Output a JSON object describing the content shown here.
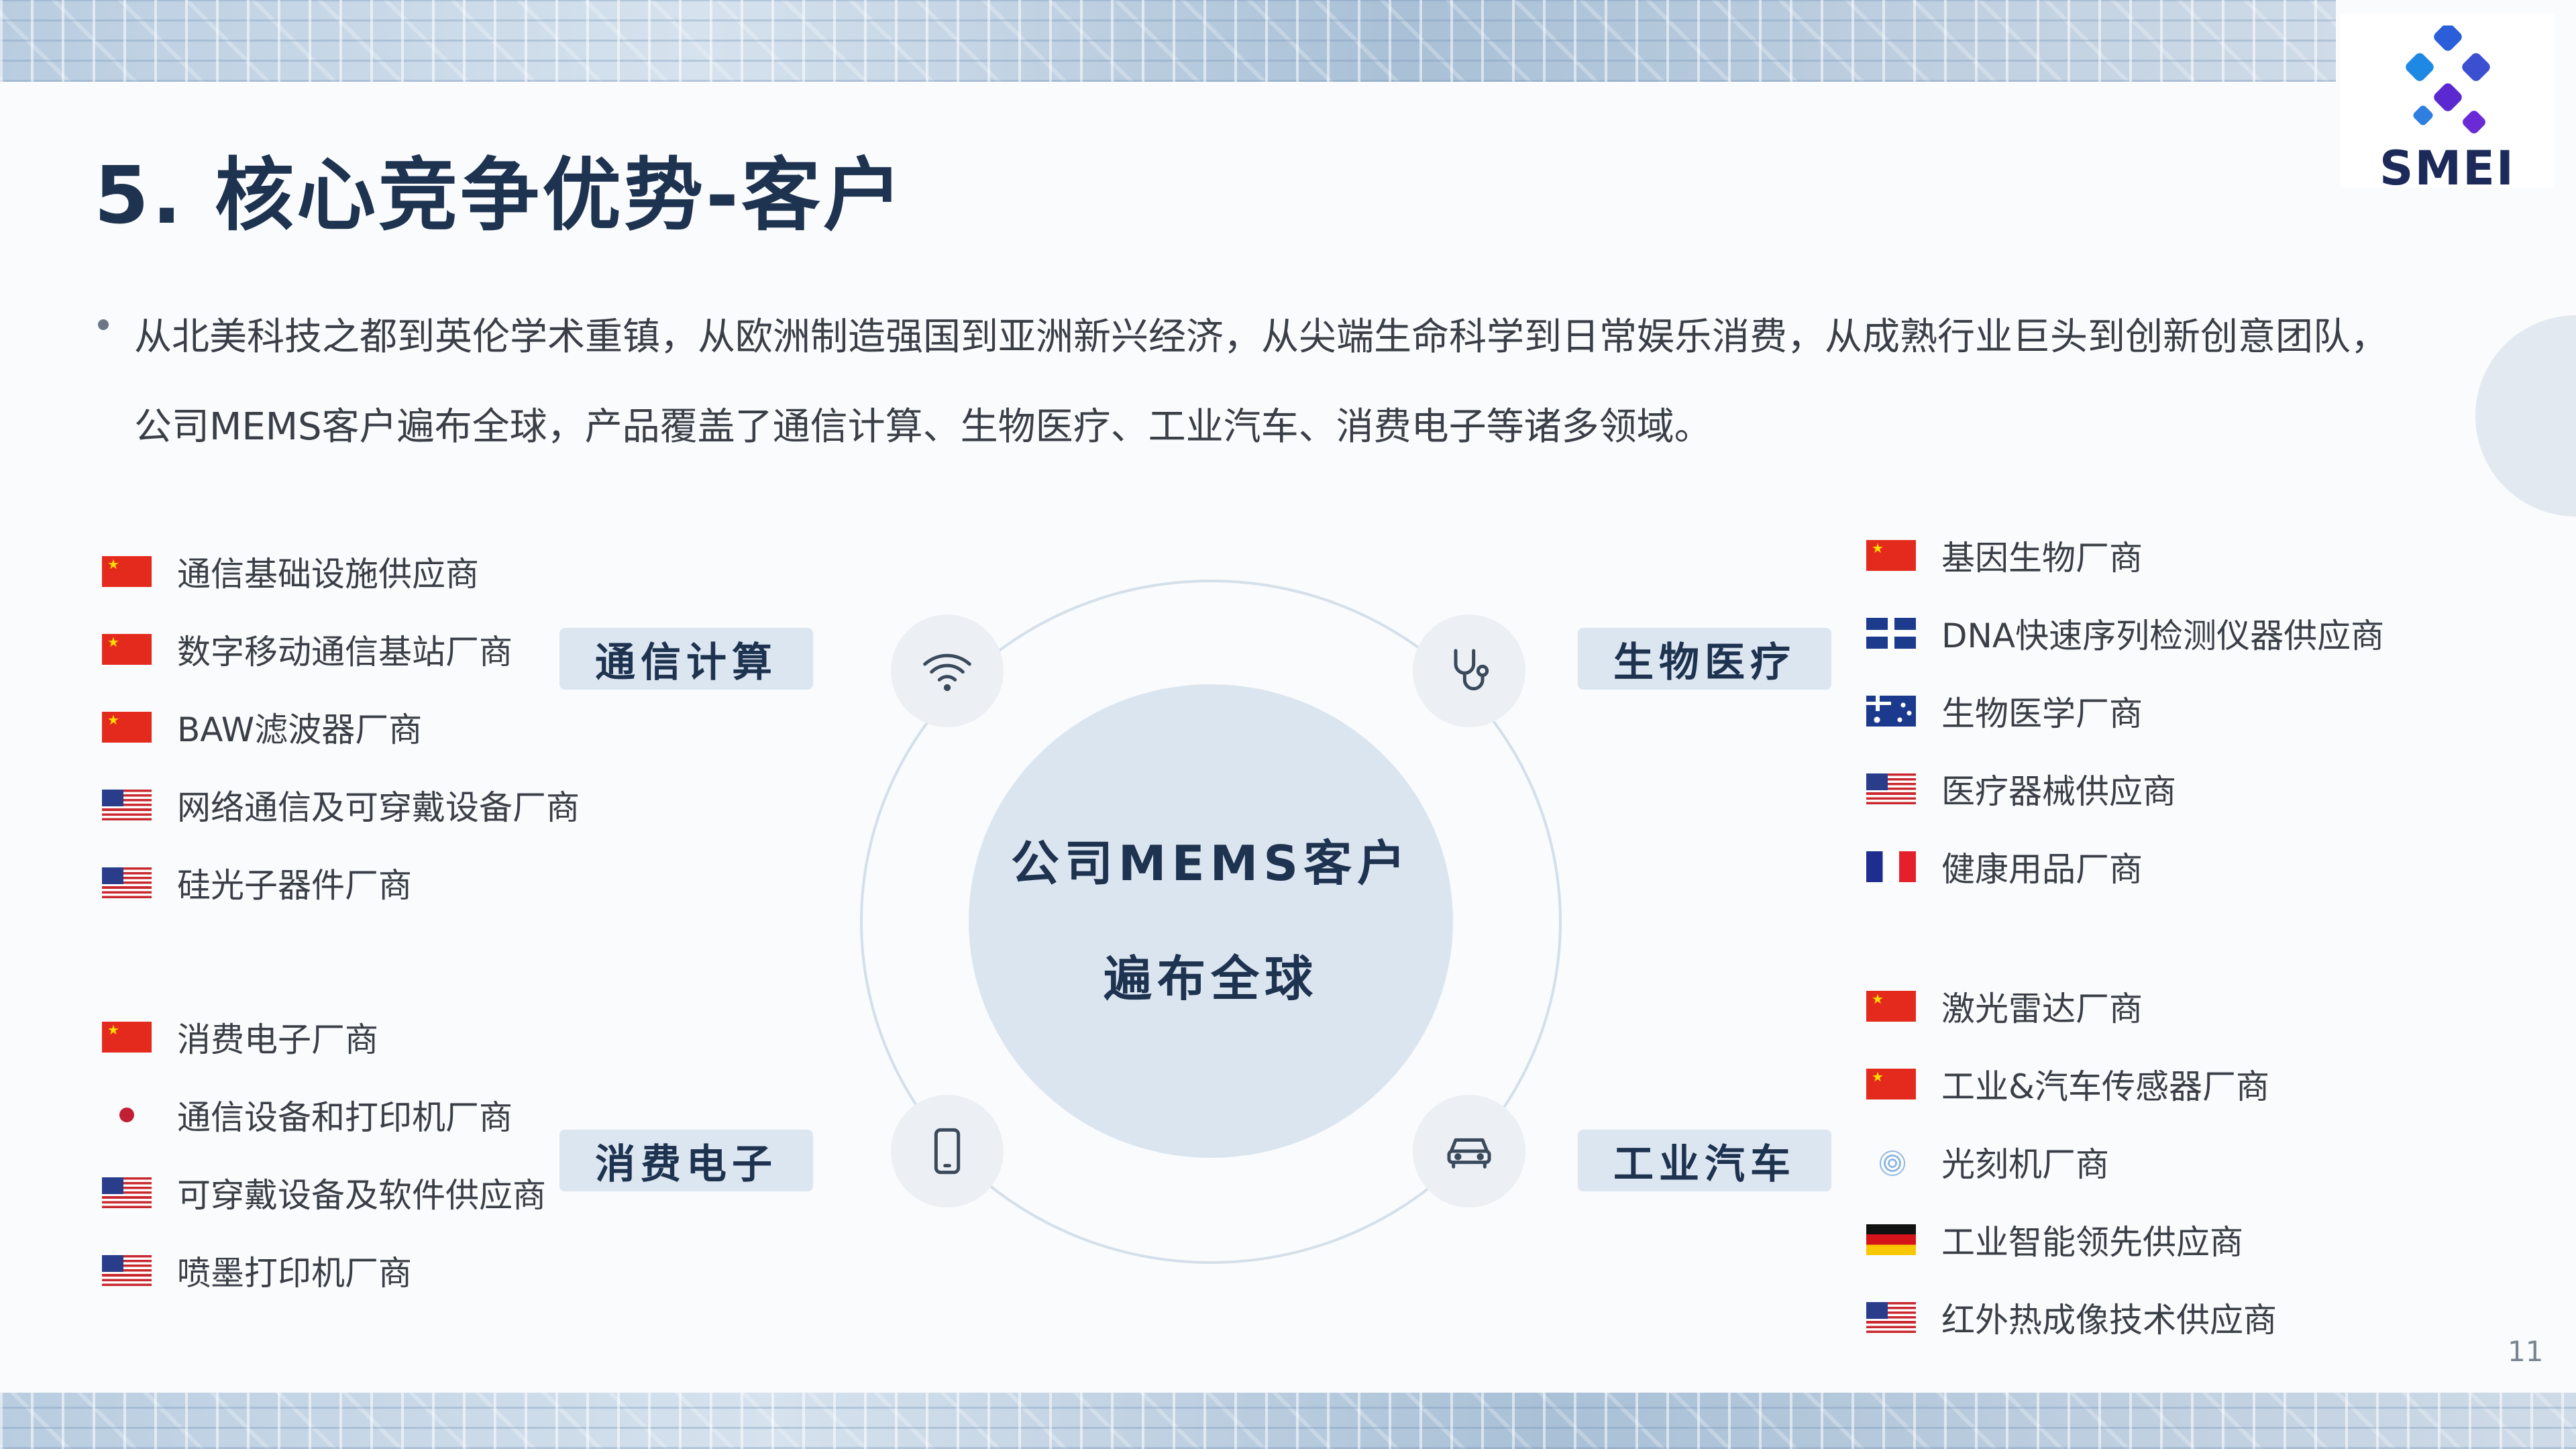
{
  "title": "5. 核心竞争优势-客户",
  "logo": {
    "text": "SMEI"
  },
  "intro": {
    "line1": "从北美科技之都到英伦学术重镇，从欧洲制造强国到亚洲新兴经济，从尖端生命科学到日常娱乐消费，从成熟行业巨头到创新创意团队，",
    "line2": "公司MEMS客户遍布全球，产品覆盖了通信计算、生物医疗、工业汽车、消费电子等诸多领域。"
  },
  "center": {
    "line1": "公司MEMS客户",
    "line2": "遍布全球"
  },
  "sectors": {
    "comm": {
      "label": "通信计算",
      "icon": "wifi-icon",
      "items": [
        {
          "flag": "cn",
          "text": "通信基础设施供应商"
        },
        {
          "flag": "cn",
          "text": "数字移动通信基站厂商"
        },
        {
          "flag": "cn",
          "text": "BAW滤波器厂商"
        },
        {
          "flag": "us",
          "text": "网络通信及可穿戴设备厂商"
        },
        {
          "flag": "us",
          "text": "硅光子器件厂商"
        }
      ]
    },
    "consumer": {
      "label": "消费电子",
      "icon": "smartphone-icon",
      "items": [
        {
          "flag": "cn",
          "text": "消费电子厂商"
        },
        {
          "flag": "jp",
          "text": "通信设备和打印机厂商"
        },
        {
          "flag": "us",
          "text": "可穿戴设备及软件供应商"
        },
        {
          "flag": "us",
          "text": "喷墨打印机厂商"
        }
      ]
    },
    "bio": {
      "label": "生物医疗",
      "icon": "stethoscope-icon",
      "items": [
        {
          "flag": "cn",
          "text": "基因生物厂商"
        },
        {
          "flag": "uk",
          "text": "DNA快速序列检测仪器供应商"
        },
        {
          "flag": "au",
          "text": "生物医学厂商"
        },
        {
          "flag": "us",
          "text": "医疗器械供应商"
        },
        {
          "flag": "fr",
          "text": "健康用品厂商"
        }
      ]
    },
    "auto": {
      "label": "工业汽车",
      "icon": "car-icon",
      "items": [
        {
          "flag": "cn",
          "text": "激光雷达厂商"
        },
        {
          "flag": "cn",
          "text": "工业&汽车传感器厂商"
        },
        {
          "flag": "un",
          "text": "光刻机厂商"
        },
        {
          "flag": "de",
          "text": "工业智能领先供应商"
        },
        {
          "flag": "us",
          "text": "红外热成像技术供应商"
        }
      ]
    }
  },
  "page_number": "11",
  "colors": {
    "title": "#1e3350",
    "tag_bg": "#dce6f1",
    "core_bg": "#dbe5f0",
    "ring": "#d4dfea"
  }
}
